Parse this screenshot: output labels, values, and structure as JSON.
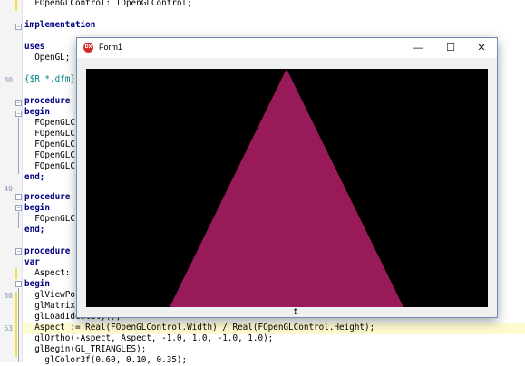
{
  "editor": {
    "line_numbers": [
      "30",
      "40",
      "50",
      "53"
    ],
    "lines": [
      "  FOpenGLControl: TOpenGLControl;",
      "",
      "implementation",
      "",
      "uses",
      "  OpenGL;",
      "",
      "{$R *.dfm}",
      "",
      "procedure",
      "begin",
      "  FOpenGLC",
      "  FOpenGLC",
      "  FOpenGLC",
      "  FOpenGLC",
      "  FOpenGLC",
      "end;",
      "",
      "procedure",
      "begin",
      "  FOpenGLC",
      "end;",
      "",
      "procedure",
      "var",
      "  Aspect:",
      "begin",
      "  glViewPo",
      "  glMatrix",
      "  glLoadIdentity();",
      "  Aspect := Real(FOpenGLControl.Width) / Real(FOpenGLControl.Height);",
      "  glOrtho(-Aspect, Aspect, -1.0, 1.0, -1.0, 1.0);",
      "  glBegin(GL_TRIANGLES);",
      "    glColor3f(0.60, 0.10, 0.35);"
    ]
  },
  "window": {
    "title": "Form1",
    "icon_text": "DX",
    "minimize_icon": "minimize-icon",
    "maximize_icon": "maximize-icon",
    "close_icon": "close-icon",
    "controls": {
      "minimize": "—",
      "maximize": "☐",
      "close": "✕"
    }
  },
  "scene": {
    "background_color": "#000000",
    "triangle_color": "#991a59",
    "triangle_rgb": [
      0.6,
      0.1,
      0.35
    ]
  },
  "cursor": {
    "glyph": "↕"
  }
}
